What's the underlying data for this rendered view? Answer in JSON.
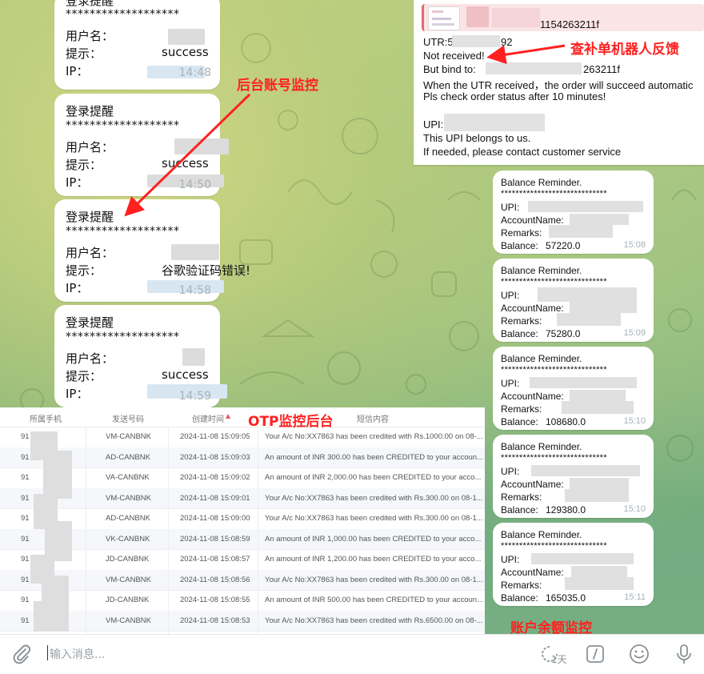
{
  "login_reminders": [
    {
      "title": "登录提醒",
      "stars": "*******************",
      "user_label": "用户名：",
      "hint_label": "提示：",
      "hint_value": "success",
      "ip_label": "IP：",
      "time": "14:48"
    },
    {
      "title": "登录提醒",
      "stars": "*******************",
      "user_label": "用户名：",
      "hint_label": "提示：",
      "hint_value": "success",
      "ip_label": "IP：",
      "time": "14:50"
    },
    {
      "title": "登录提醒",
      "stars": "*******************",
      "user_label": "用户名：",
      "hint_label": "提示：",
      "hint_value": "谷歌验证码错误!",
      "ip_label": "IP：",
      "time": "14:58"
    },
    {
      "title": "登录提醒",
      "stars": "*******************",
      "user_label": "用户名：",
      "hint_label": "提示：",
      "hint_value": "success",
      "ip_label": "IP：",
      "time": "14:59"
    }
  ],
  "feedback": {
    "quote_suffix": "1154263211f",
    "utr_prefix": "UTR:5",
    "utr_suffix": "92",
    "not_received": "Not received!",
    "bind_label": "But bind to:",
    "bind_suffix": "263211f",
    "line_success": "When the UTR received，the order will succeed automatic",
    "line_check": "Pls check order status after 10 minutes!",
    "upi_label": "UPI:",
    "line_belongs": "This UPI belongs to us.",
    "line_contact": "If needed, please contact customer service"
  },
  "balance_reminders": [
    {
      "title": "Balance Reminder.",
      "stars": "*****************************",
      "upi": "UPI:",
      "account": "AccountName:",
      "remarks": "Remarks:",
      "balance_label": "Balance:",
      "balance": "57220.0",
      "time": "15:08"
    },
    {
      "title": "Balance Reminder.",
      "stars": "*****************************",
      "upi": "UPI:",
      "account": "AccountName:",
      "remarks": "Remarks:",
      "balance_label": "Balance:",
      "balance": "75280.0",
      "time": "15:09"
    },
    {
      "title": "Balance Reminder.",
      "stars": "*****************************",
      "upi": "UPI:",
      "account": "AccountName:",
      "remarks": "Remarks:",
      "balance_label": "Balance:",
      "balance": "108680.0",
      "time": "15:10"
    },
    {
      "title": "Balance Reminder.",
      "stars": "*****************************",
      "upi": "UPI:",
      "account": "AccountName:",
      "remarks": "Remarks:",
      "balance_label": "Balance:",
      "balance": "129380.0",
      "time": "15:10"
    },
    {
      "title": "Balance Reminder.",
      "stars": "*****************************",
      "upi": "UPI:",
      "account": "AccountName:",
      "remarks": "Remarks:",
      "balance_label": "Balance:",
      "balance": "165035.0",
      "time": "15:11"
    }
  ],
  "otp_table": {
    "headers": [
      "所属手机",
      "发送号码",
      "创建时间",
      "短信内容"
    ],
    "rows": [
      {
        "phone": "91",
        "sender": "VM-CANBNK",
        "time": "2024-11-08 15:09:05",
        "content": "Your A/c No:XX7863 has been credited with Rs.1000.00 on 08-..."
      },
      {
        "phone": "91",
        "sender": "AD-CANBNK",
        "time": "2024-11-08 15:09:03",
        "content": "An amount of INR 300.00 has been CREDITED to your accoun..."
      },
      {
        "phone": "91",
        "sender": "VA-CANBNK",
        "time": "2024-11-08 15:09:02",
        "content": "An amount of INR 2,000.00 has been CREDITED to your acco..."
      },
      {
        "phone": "91",
        "sender": "VM-CANBNK",
        "time": "2024-11-08 15:09:01",
        "content": "Your A/c No:XX7863 has been credited with Rs.300.00 on 08-1..."
      },
      {
        "phone": "91",
        "sender": "AD-CANBNK",
        "time": "2024-11-08 15:09:00",
        "content": "Your A/c No:XX7863 has been credited with Rs.300.00 on 08-1..."
      },
      {
        "phone": "91",
        "sender": "VK-CANBNK",
        "time": "2024-11-08 15:08:59",
        "content": "An amount of INR 1,000.00 has been CREDITED to your acco..."
      },
      {
        "phone": "91",
        "sender": "JD-CANBNK",
        "time": "2024-11-08 15:08:57",
        "content": "An amount of INR 1,200.00 has been CREDITED to your acco..."
      },
      {
        "phone": "91",
        "sender": "VM-CANBNK",
        "time": "2024-11-08 15:08:56",
        "content": "Your A/c No:XX7863 has been credited with Rs.300.00 on 08-1..."
      },
      {
        "phone": "91",
        "sender": "JD-CANBNK",
        "time": "2024-11-08 15:08:55",
        "content": "An amount of INR 500.00 has been CREDITED to your accoun..."
      },
      {
        "phone": "91",
        "sender": "VM-CANBNK",
        "time": "2024-11-08 15:08:53",
        "content": "Your A/c No:XX7863 has been credited with Rs.6500.00 on 08-..."
      }
    ]
  },
  "annotations": {
    "backend": "后台账号监控",
    "feedback_bot": "查补单机器人反馈",
    "otp": "OTP监控后台",
    "balance": "账户余额监控"
  },
  "composer": {
    "placeholder": "输入消息...",
    "timer_badge": "1天"
  },
  "colors": {
    "annotation_red": "#ff2020",
    "bubble_bg": "#ffffff",
    "time_gray": "#a8b1b8"
  }
}
